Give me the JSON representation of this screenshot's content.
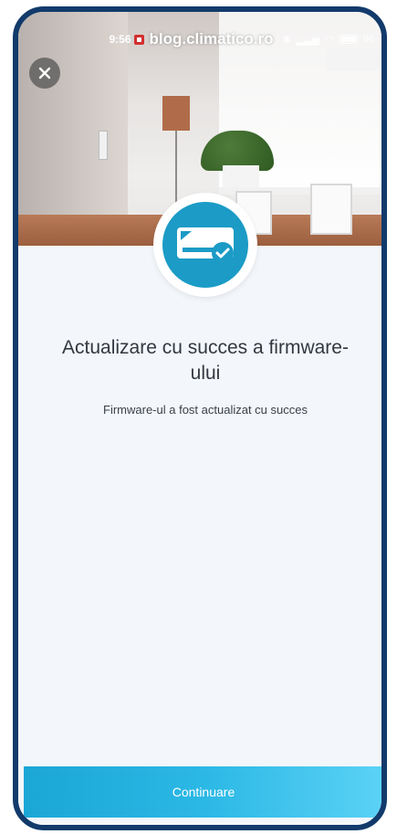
{
  "status_bar": {
    "time": "9:56",
    "watermark": "blog.climatico.ro",
    "battery": "96"
  },
  "icons": {
    "close": "close-icon",
    "device": "ac-unit-check-icon"
  },
  "main": {
    "title": "Actualizare cu succes a firmware-ului",
    "subtitle": "Firmware-ul a fost actualizat cu succes",
    "continue_label": "Continuare"
  },
  "colors": {
    "accent": "#1b9bc6",
    "button_gradient_start": "#1ba7d6",
    "button_gradient_end": "#5bd2f6",
    "frame": "#123a6b"
  }
}
